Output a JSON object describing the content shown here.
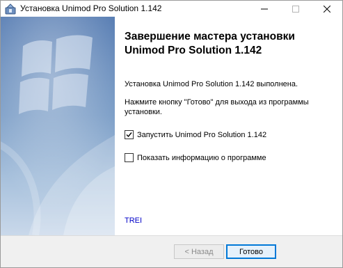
{
  "window": {
    "title": "Установка Unimod Pro Solution 1.142",
    "controls": {
      "minimize_icon": "minimize-icon",
      "maximize_icon": "maximize-icon",
      "close_icon": "close-icon"
    }
  },
  "main": {
    "heading": "Завершение мастера установки Unimod Pro Solution 1.142",
    "completed_text": "Установка Unimod Pro Solution 1.142 выполнена.",
    "instruction_text": "Нажмите кнопку \"Готово\" для выхода из программы установки.",
    "checkboxes": [
      {
        "label": "Запустить Unimod Pro Solution 1.142",
        "checked": true
      },
      {
        "label": "Показать информацию о программе",
        "checked": false
      }
    ],
    "footer_link": "TREI"
  },
  "footer": {
    "back_label": "< Назад",
    "finish_label": "Готово"
  },
  "colors": {
    "accent": "#0078d7",
    "link": "#0000c8",
    "footer_bg": "#f0f0f0"
  }
}
